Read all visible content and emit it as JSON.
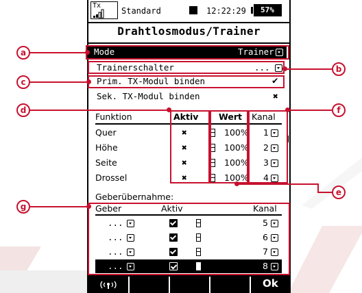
{
  "status": {
    "tx": "Tx",
    "model_name": "Standard",
    "time": "12:22:29",
    "battery": "57%"
  },
  "title": "Drahtlosmodus/Trainer",
  "settings": {
    "mode_label": "Mode",
    "mode_value": "Trainer",
    "trainer_switch_label": "Trainerschalter",
    "trainer_switch_value": "...",
    "prim_bind_label": "Prim. TX-Modul binden",
    "sek_bind_label": "Sek. TX-Modul binden"
  },
  "functions": {
    "headers": {
      "funktion": "Funktion",
      "aktiv": "Aktiv",
      "wert": "Wert",
      "kanal": "Kanal"
    },
    "rows": [
      {
        "name": "Quer",
        "wert": "100%",
        "kanal": "1"
      },
      {
        "name": "Höhe",
        "wert": "100%",
        "kanal": "2"
      },
      {
        "name": "Seite",
        "wert": "100%",
        "kanal": "3"
      },
      {
        "name": "Drossel",
        "wert": "100%",
        "kanal": "4"
      }
    ]
  },
  "geber": {
    "section_label": "Geberübernahme:",
    "headers": {
      "geber": "Geber",
      "aktiv": "Aktiv",
      "kanal": "Kanal"
    },
    "rows": [
      {
        "geber": "...",
        "kanal": "5",
        "selected": false
      },
      {
        "geber": "...",
        "kanal": "6",
        "selected": false
      },
      {
        "geber": "...",
        "kanal": "7",
        "selected": false
      },
      {
        "geber": "...",
        "kanal": "8",
        "selected": true
      }
    ]
  },
  "softkeys": {
    "wireless_icon": "wireless-icon",
    "ok": "Ok"
  },
  "callouts": [
    "a",
    "b",
    "c",
    "d",
    "e",
    "f",
    "g"
  ],
  "colors": {
    "annotation": "#c8102e",
    "screen": "#000000"
  }
}
